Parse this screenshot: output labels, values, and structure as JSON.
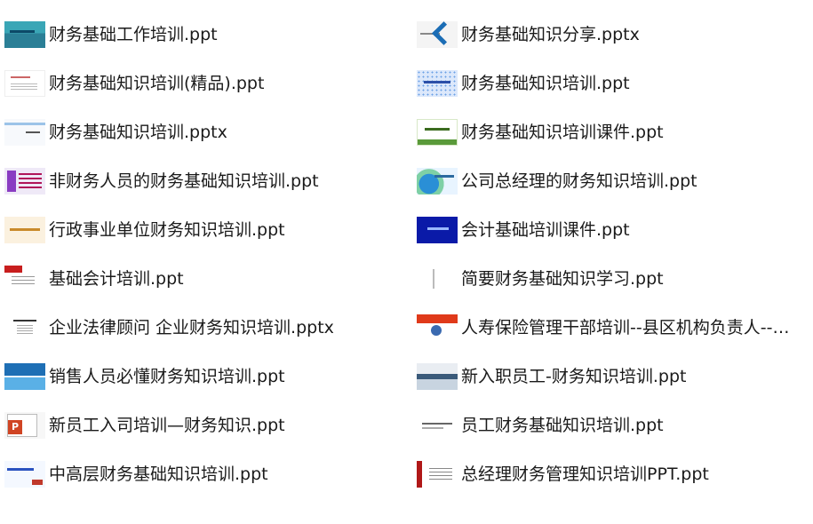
{
  "files": {
    "left": [
      {
        "name": "财务基础工作培训.ppt",
        "thumb": "thumb-teal-slide"
      },
      {
        "name": "财务基础知识培训(精品).ppt",
        "thumb": "thumb-white-slide"
      },
      {
        "name": "财务基础知识培训.pptx",
        "thumb": "thumb-light-slide"
      },
      {
        "name": "非财务人员的财务基础知识培训.ppt",
        "thumb": "thumb-purple-slide"
      },
      {
        "name": "行政事业单位财务知识培训.ppt",
        "thumb": "thumb-beige-slide"
      },
      {
        "name": "基础会计培训.ppt",
        "thumb": "thumb-red-corner-slide"
      },
      {
        "name": "企业法律顾问 企业财务知识培训.pptx",
        "thumb": "thumb-doc-slide"
      },
      {
        "name": "销售人员必懂财务知识培训.ppt",
        "thumb": "thumb-sea-slide"
      },
      {
        "name": "新员工入司培训—财务知识.ppt",
        "thumb": "ppt-file-icon"
      },
      {
        "name": "中高层财务基础知识培训.ppt",
        "thumb": "thumb-blue-stripe-slide"
      }
    ],
    "right": [
      {
        "name": "财务基础知识分享.pptx",
        "thumb": "thumb-chevron-slide"
      },
      {
        "name": "财务基础知识培训.ppt",
        "thumb": "thumb-blue-dots-slide"
      },
      {
        "name": "财务基础知识培训课件.ppt",
        "thumb": "thumb-green-title-slide"
      },
      {
        "name": "公司总经理的财务知识培训.ppt",
        "thumb": "thumb-swirl-slide"
      },
      {
        "name": "会计基础培训课件.ppt",
        "thumb": "thumb-navy-slide"
      },
      {
        "name": "简要财务基础知识学习.ppt",
        "thumb": "thumb-plain-slide"
      },
      {
        "name": "人寿保险管理干部培训--县区机构负责人--基...",
        "thumb": "thumb-red-banner-slide"
      },
      {
        "name": "新入职员工-财务知识培训.ppt",
        "thumb": "thumb-ship-slide"
      },
      {
        "name": "员工财务基础知识培训.ppt",
        "thumb": "thumb-gray-title-slide"
      },
      {
        "name": "总经理财务管理知识培训PPT.ppt",
        "thumb": "thumb-red-side-slide"
      }
    ]
  }
}
